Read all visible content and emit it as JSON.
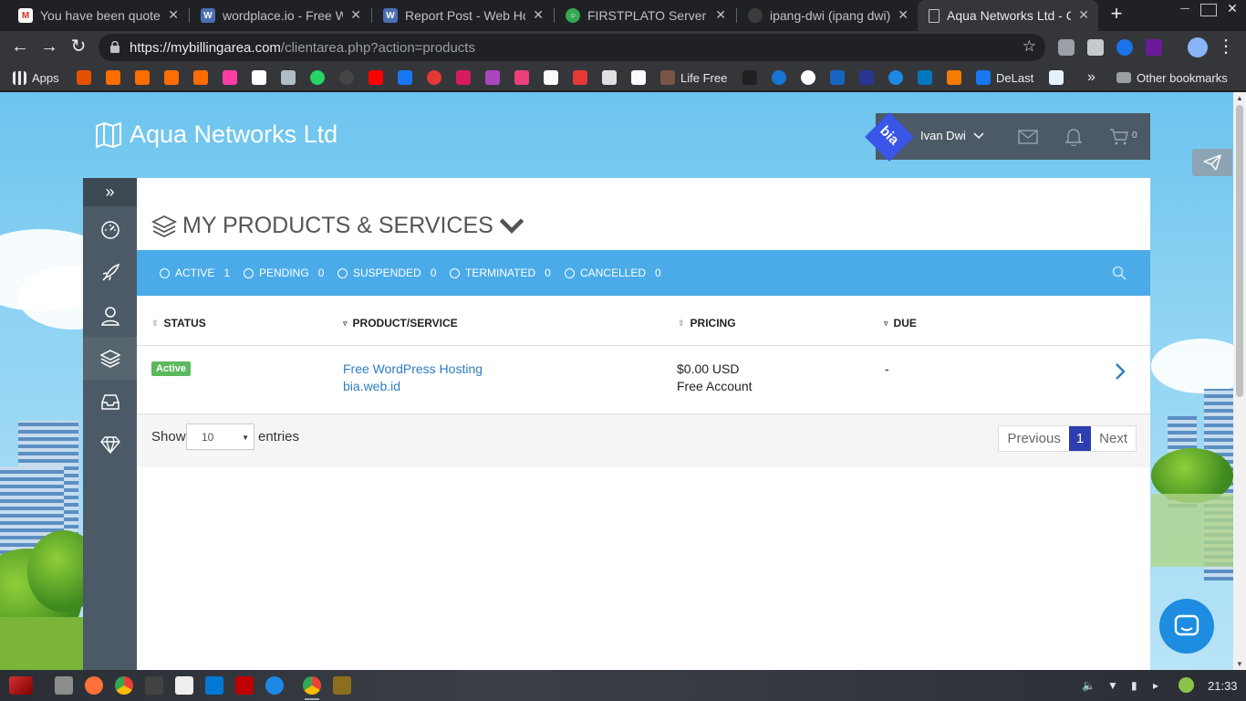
{
  "browser": {
    "tabs": [
      {
        "title": "You have been quoted",
        "icon": "gmail-icon",
        "color": "#d93025",
        "glyph": "M"
      },
      {
        "title": "wordplace.io - Free Wo",
        "icon": "wordplace-icon",
        "color": "#4a6fb3",
        "glyph": "W"
      },
      {
        "title": "Report Post - Web Host",
        "icon": "wordplace-icon",
        "color": "#4a6fb3",
        "glyph": "W"
      },
      {
        "title": "FIRSTPLATO Server Sta",
        "icon": "status-icon",
        "color": "#34a853",
        "glyph": "O"
      },
      {
        "title": "ipang-dwi (ipang dwi)",
        "icon": "github-icon",
        "color": "#3c3c3c",
        "glyph": ""
      },
      {
        "title": "Aqua Networks Ltd - C",
        "icon": "page-icon",
        "color": "#5f6368",
        "glyph": ""
      }
    ],
    "new_tab": "+",
    "url_host": "https://mybillingarea.com",
    "url_path": "/clientarea.php?action=products",
    "bookmarks": {
      "apps": "Apps",
      "life_free": "Life Free",
      "delast": "DeLast",
      "more": "»",
      "other": "Other bookmarks"
    }
  },
  "site": {
    "brand": "Aqua Networks Ltd",
    "user": {
      "name": "Ivan Dwi",
      "avatar_text": "bia",
      "cart_count": "0"
    },
    "sidebar_icons": [
      "dashboard-icon",
      "rocket-icon",
      "user-icon",
      "layers-icon",
      "inbox-icon",
      "diamond-icon"
    ],
    "page_title": "MY PRODUCTS & SERVICES",
    "filters": [
      {
        "label": "ACTIVE",
        "count": "1"
      },
      {
        "label": "PENDING",
        "count": "0"
      },
      {
        "label": "SUSPENDED",
        "count": "0"
      },
      {
        "label": "TERMINATED",
        "count": "0"
      },
      {
        "label": "CANCELLED",
        "count": "0"
      }
    ],
    "table": {
      "columns": [
        "STATUS",
        "PRODUCT/SERVICE",
        "PRICING",
        "DUE"
      ],
      "rows": [
        {
          "status": "Active",
          "product": "Free WordPress Hosting",
          "domain": "bia.web.id",
          "price": "$0.00 USD",
          "cycle": "Free Account",
          "due": "-"
        }
      ]
    },
    "footer": {
      "show": "Show",
      "entries_value": "10",
      "entries": "entries",
      "previous": "Previous",
      "page": "1",
      "next": "Next"
    },
    "colors": {
      "accent": "#4aabe8",
      "sidebar": "#4b5a66",
      "active_badge": "#5cb85c",
      "pager_current": "#2d3db2"
    }
  },
  "taskbar": {
    "clock": "21:33"
  }
}
